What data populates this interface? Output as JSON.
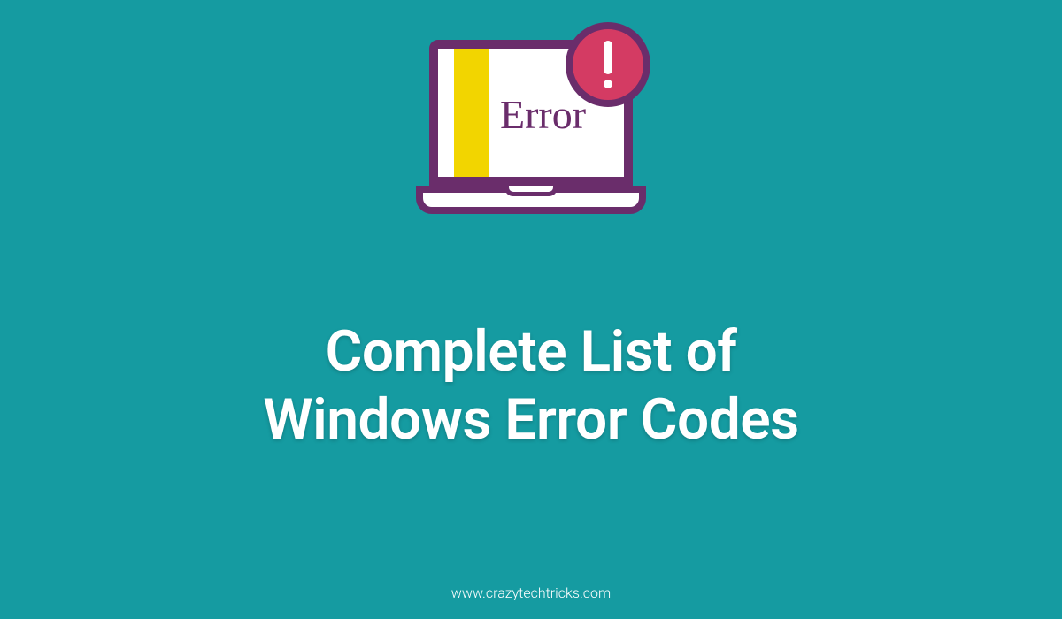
{
  "icon": {
    "error_label": "Error"
  },
  "heading": {
    "line1": "Complete List of",
    "line2": "Windows Error Codes"
  },
  "footer": {
    "url": "www.crazytechtricks.com"
  },
  "colors": {
    "background": "#159ba1",
    "laptop_border": "#6a2d6b",
    "stripe": "#f2d500",
    "badge": "#d43b63",
    "text_main": "#ffffff"
  }
}
